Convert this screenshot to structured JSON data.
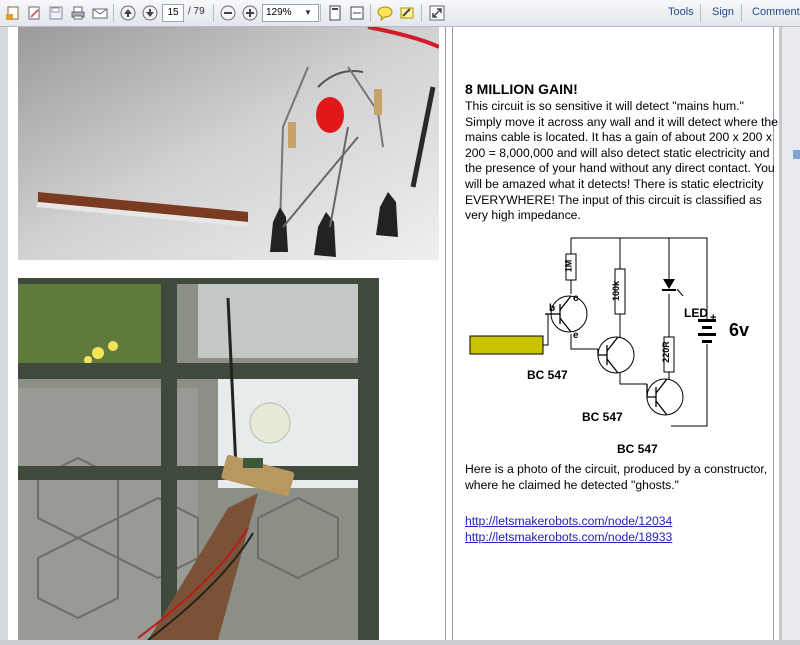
{
  "toolbar": {
    "page_current": "15",
    "page_total": "/ 79",
    "zoom": "129%",
    "tools_label": "Tools",
    "sign_label": "Sign",
    "comment_label": "Comment"
  },
  "article": {
    "title": "8 MILLION GAIN!",
    "paragraph1": "This circuit is so sensitive it will detect \"mains hum.\" Simply move it across any wall and it will detect where the mains cable is located. It has a gain of about 200 x 200 x 200 = 8,000,000 and will also detect static electricity and the presence of your hand without any direct contact. You will be amazed what it detects! There is static electricity EVERYWHERE! The input of this circuit is classified as very high impedance.",
    "paragraph2": "Here is a photo of the circuit, produced by a constructor, where he claimed he detected \"ghosts.\"",
    "link1": "http://letsmakerobots.com/node/12034",
    "link2": "http://letsmakerobots.com/node/18933"
  },
  "schematic": {
    "transistor1": "BC 547",
    "transistor2": "BC 547",
    "transistor3": "BC 547",
    "resistor1": "1M",
    "resistor2": "100k",
    "resistor3": "220R",
    "led_label": "LED",
    "battery_label": "6v",
    "pin_b": "b",
    "pin_c": "c",
    "pin_e": "e",
    "plus": "+"
  },
  "colors": {
    "link": "#2323b6",
    "input_plate": "#c8c400"
  }
}
